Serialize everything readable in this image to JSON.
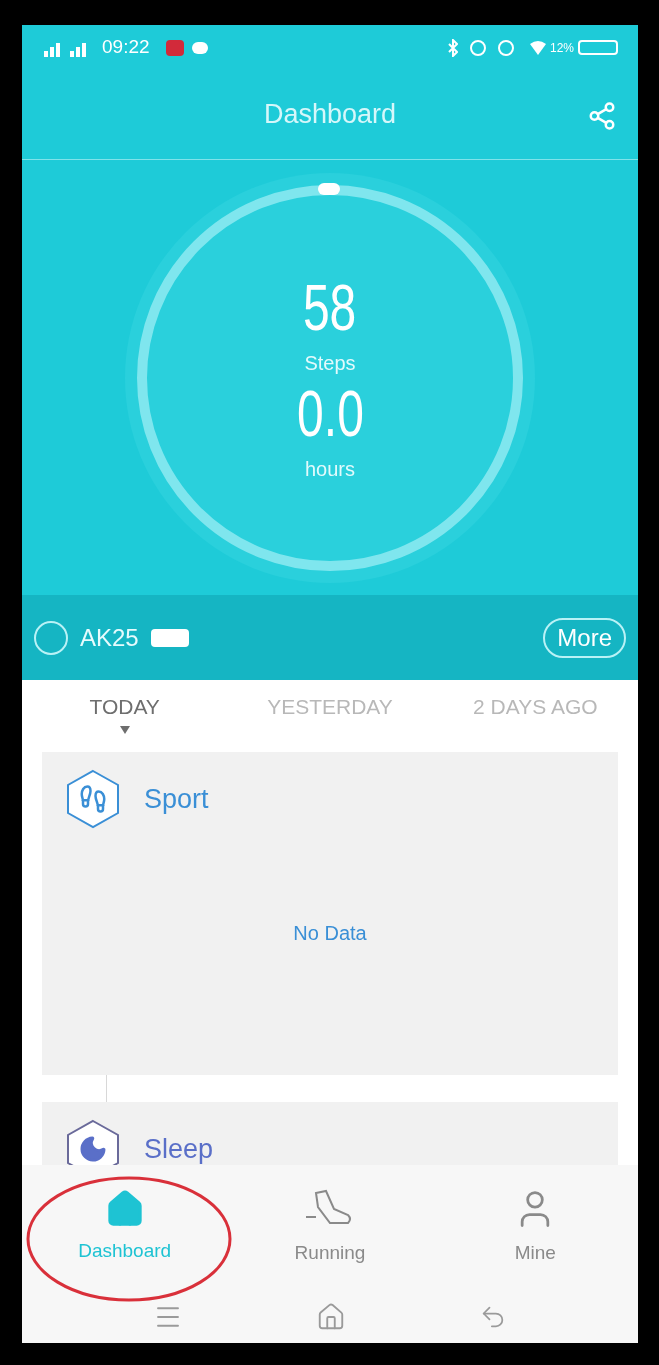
{
  "status_bar": {
    "time": "09:22",
    "battery": "12%"
  },
  "header": {
    "title": "Dashboard"
  },
  "summary": {
    "steps_value": "58",
    "steps_label": "Steps",
    "hours_value": "0.0",
    "hours_label": "hours"
  },
  "device": {
    "name": "AK25",
    "more_button": "More"
  },
  "day_tabs": [
    {
      "label": "TODAY",
      "selected": true
    },
    {
      "label": "YESTERDAY",
      "selected": false
    },
    {
      "label": "2 DAYS AGO",
      "selected": false
    }
  ],
  "cards": [
    {
      "kind": "sport",
      "title": "Sport",
      "message": "No Data"
    },
    {
      "kind": "sleep",
      "title": "Sleep"
    }
  ],
  "bottom_nav": [
    {
      "label": "Dashboard",
      "kind": "home",
      "selected": true
    },
    {
      "label": "Running",
      "kind": "shoe",
      "selected": false
    },
    {
      "label": "Mine",
      "kind": "person",
      "selected": false
    }
  ]
}
